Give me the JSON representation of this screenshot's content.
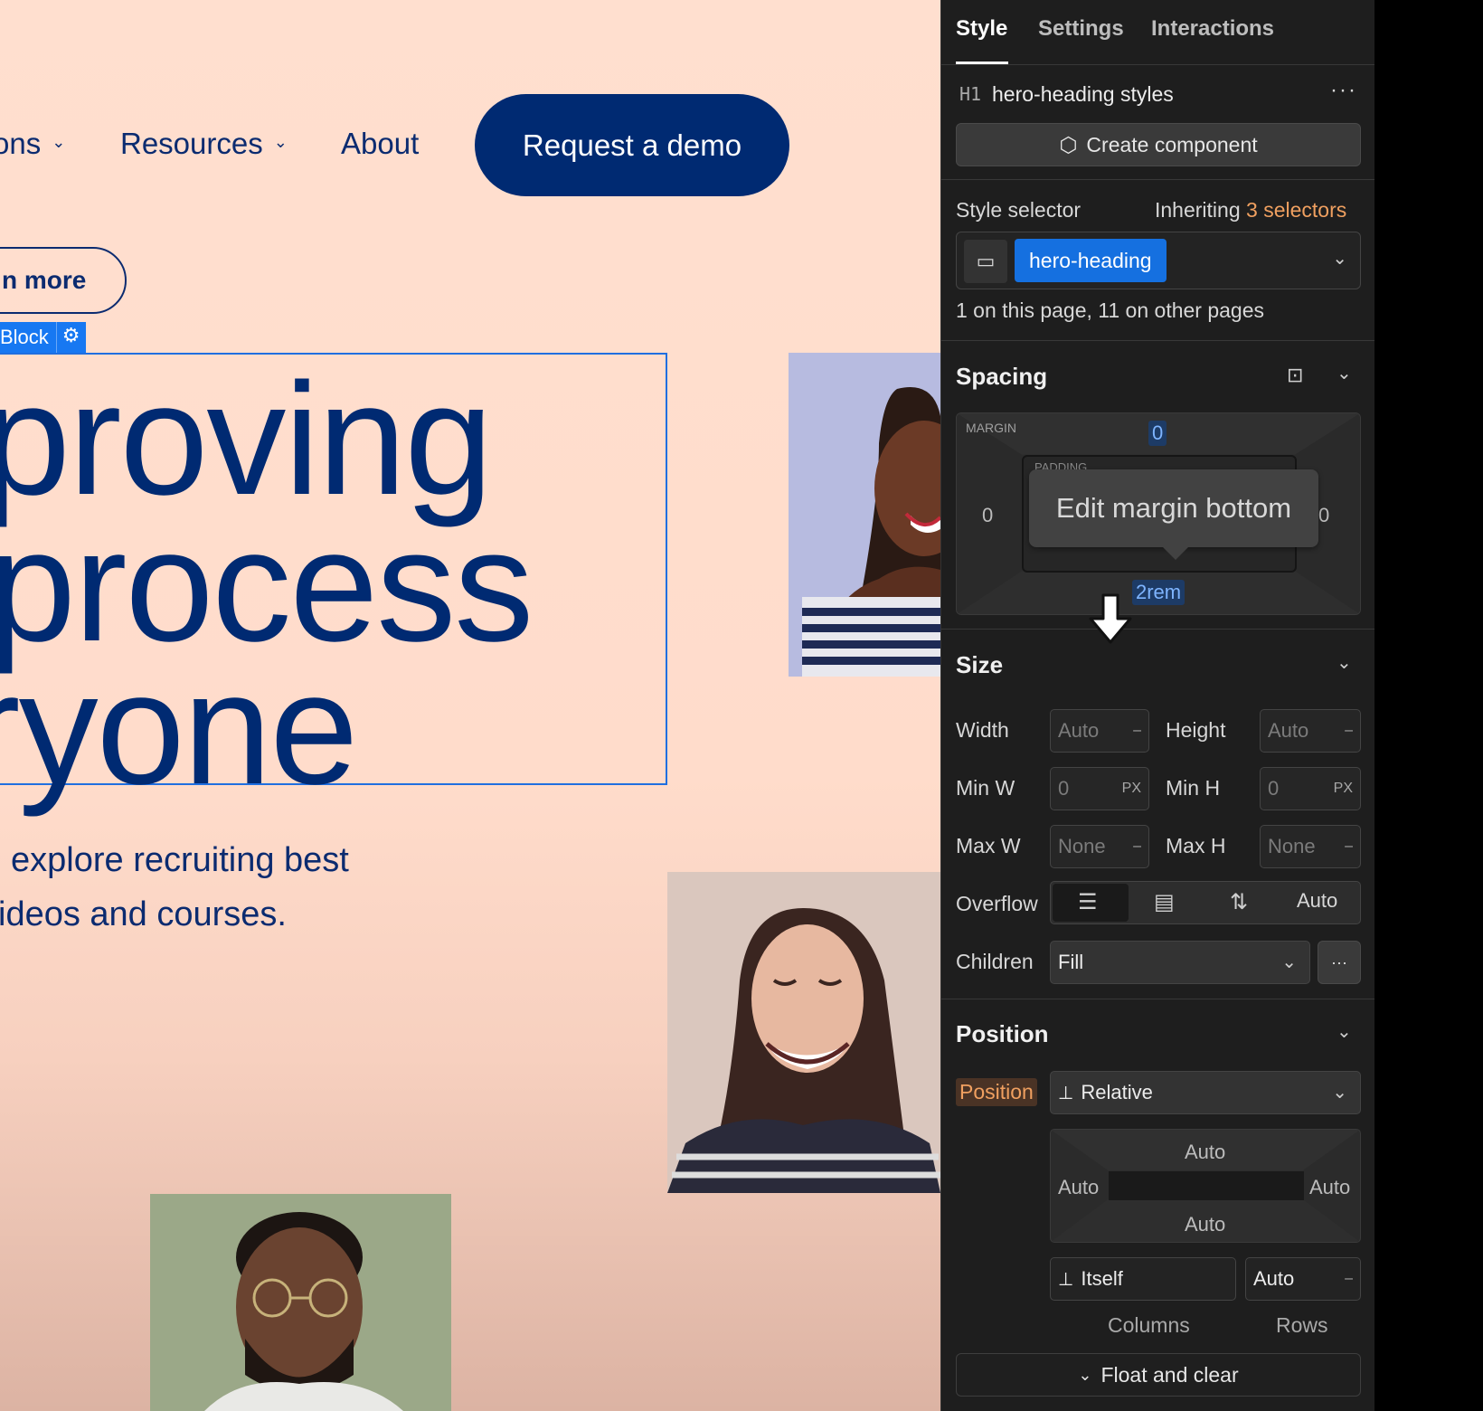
{
  "canvas": {
    "nav": {
      "solutions_partial": "ons",
      "resources": "Resources",
      "about": "About",
      "demo_button": "Request a demo"
    },
    "learn_more_partial": "n more",
    "block_tag": "Block",
    "hero_lines": [
      "proving",
      "process",
      "ryone"
    ],
    "sub_lines": [
      "explore recruiting best",
      "ideos and courses."
    ]
  },
  "panel": {
    "tabs": [
      {
        "label": "Style",
        "active": true
      },
      {
        "label": "Settings",
        "active": false
      },
      {
        "label": "Interactions",
        "active": false
      }
    ],
    "element_tag": "H1",
    "element_styles": "hero-heading styles",
    "more_icon": "···",
    "create_component": "Create component",
    "style_selector_label": "Style selector",
    "inheriting_label": "Inheriting",
    "inheriting_count": "3 selectors",
    "selector_chip": "hero-heading",
    "usage_text": "1 on this page, 11 on other pages",
    "spacing": {
      "title": "Spacing",
      "margin_label": "MARGIN",
      "padding_label": "PADDING",
      "margin_top": "0",
      "margin_left": "0",
      "margin_right": "0",
      "margin_bottom": "2rem",
      "tooltip": "Edit margin bottom"
    },
    "size": {
      "title": "Size",
      "width_label": "Width",
      "width_value": "Auto",
      "height_label": "Height",
      "height_value": "Auto",
      "minw_label": "Min W",
      "minw_value": "0",
      "minw_unit": "PX",
      "minh_label": "Min H",
      "minh_value": "0",
      "minh_unit": "PX",
      "maxw_label": "Max W",
      "maxw_value": "None",
      "maxh_label": "Max H",
      "maxh_value": "None",
      "dash": "–",
      "overflow_label": "Overflow",
      "overflow_auto": "Auto",
      "children_label": "Children",
      "children_value": "Fill"
    },
    "position": {
      "title": "Position",
      "label": "Position",
      "value": "Relative",
      "top": "Auto",
      "left": "Auto",
      "right": "Auto",
      "bottom": "Auto",
      "itself": "Itself",
      "auto": "Auto",
      "columns": "Columns",
      "rows": "Rows",
      "float_clear": "Float and clear"
    },
    "colors": {
      "accent_orange": "#f0a060",
      "selector_blue": "#1570e0",
      "panel_bg": "#1e1e1e"
    }
  }
}
